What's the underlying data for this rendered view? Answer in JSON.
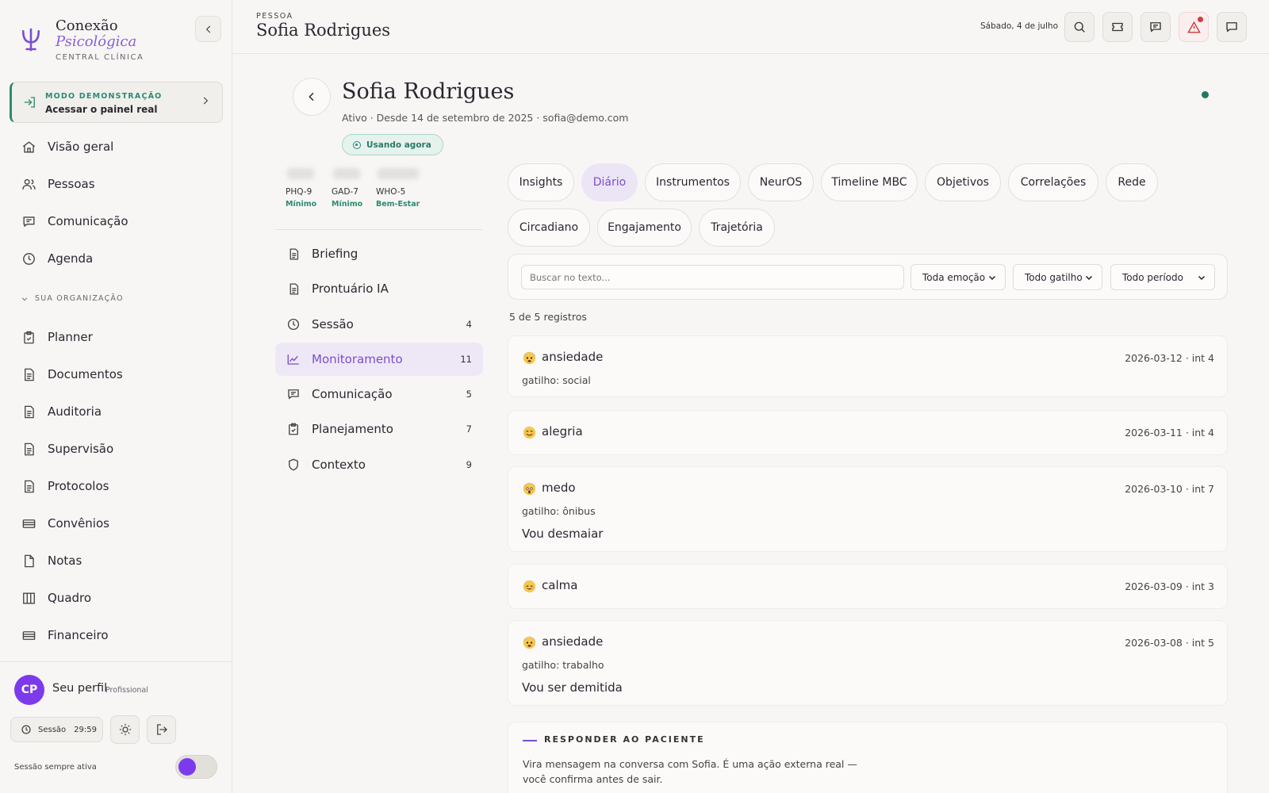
{
  "brand": {
    "line1": "Conexão",
    "line2": "Psicológica",
    "line3": "CENTRAL CLÍNICA"
  },
  "demo": {
    "label": "MODO DEMONSTRAÇÃO",
    "text": "Acessar o painel real"
  },
  "nav": {
    "items": [
      {
        "label": "Visão geral",
        "icon": "home-icon"
      },
      {
        "label": "Pessoas",
        "icon": "users-icon"
      },
      {
        "label": "Comunicação",
        "icon": "chat-icon"
      },
      {
        "label": "Agenda",
        "icon": "clock-icon"
      }
    ],
    "org_label": "SUA ORGANIZAÇÃO",
    "org_items": [
      {
        "label": "Planner",
        "icon": "clipboard-check-icon"
      },
      {
        "label": "Documentos",
        "icon": "document-icon"
      },
      {
        "label": "Auditoria",
        "icon": "document-icon"
      },
      {
        "label": "Supervisão",
        "icon": "document-icon"
      },
      {
        "label": "Protocolos",
        "icon": "document-icon"
      },
      {
        "label": "Convênios",
        "icon": "card-icon"
      },
      {
        "label": "Notas",
        "icon": "file-icon"
      },
      {
        "label": "Quadro",
        "icon": "columns-icon"
      },
      {
        "label": "Financeiro",
        "icon": "card-icon"
      }
    ]
  },
  "profile": {
    "initials": "CP",
    "name": "Seu perfil",
    "role": "Profissional",
    "session_label": "Sessão",
    "session_time": "29:59",
    "always_label": "Sessão sempre ativa",
    "always_on": true
  },
  "topbar": {
    "eyebrow": "PESSOA",
    "title": "Sofia Rodrigues",
    "date": "Sábado, 4 de julho"
  },
  "patient": {
    "name": "Sofia Rodrigues",
    "meta": "Ativo · Desde 14 de setembro de 2025 · sofia@demo.com",
    "badge": "Usando agora"
  },
  "scores": [
    {
      "name": "PHQ-9",
      "severity": "Mínimo"
    },
    {
      "name": "GAD-7",
      "severity": "Mínimo"
    },
    {
      "name": "WHO-5",
      "severity": "Bem-Estar"
    }
  ],
  "sections": [
    {
      "label": "Briefing",
      "count": "",
      "icon": "document-icon"
    },
    {
      "label": "Prontuário IA",
      "count": "",
      "icon": "document-icon"
    },
    {
      "label": "Sessão",
      "count": "4",
      "icon": "clock-icon"
    },
    {
      "label": "Monitoramento",
      "count": "11",
      "icon": "line-chart-icon",
      "active": true
    },
    {
      "label": "Comunicação",
      "count": "5",
      "icon": "chat-icon"
    },
    {
      "label": "Planejamento",
      "count": "7",
      "icon": "clipboard-check-icon"
    },
    {
      "label": "Contexto",
      "count": "9",
      "icon": "shield-icon"
    }
  ],
  "tabs": [
    {
      "label": "Insights"
    },
    {
      "label": "Diário",
      "active": true
    },
    {
      "label": "Instrumentos"
    },
    {
      "label": "NeurOS"
    },
    {
      "label": "Timeline MBC"
    },
    {
      "label": "Objetivos"
    },
    {
      "label": "Correlações"
    },
    {
      "label": "Rede"
    },
    {
      "label": "Circadiano"
    },
    {
      "label": "Engajamento"
    },
    {
      "label": "Trajetória"
    }
  ],
  "filters": {
    "search_placeholder": "Buscar no texto...",
    "emotion": "Toda emoção",
    "trigger": "Todo gatilho",
    "period": "Todo período"
  },
  "records_count": "5 de 5 registros",
  "entries": [
    {
      "emotion": "ansiedade",
      "meta": "2026-03-12 · int 4",
      "trigger": "gatilho: social",
      "text": "",
      "emoji": "😰"
    },
    {
      "emotion": "alegria",
      "meta": "2026-03-11 · int 4",
      "trigger": "",
      "text": "",
      "emoji": "😊"
    },
    {
      "emotion": "medo",
      "meta": "2026-03-10 · int 7",
      "trigger": "gatilho: ônibus",
      "text": "Vou desmaiar",
      "emoji": "😱"
    },
    {
      "emotion": "calma",
      "meta": "2026-03-09 · int 3",
      "trigger": "",
      "text": "",
      "emoji": "😌"
    },
    {
      "emotion": "ansiedade",
      "meta": "2026-03-08 · int 5",
      "trigger": "gatilho: trabalho",
      "text": "Vou ser demitida",
      "emoji": "😰"
    }
  ],
  "reply": {
    "title": "RESPONDER AO PACIENTE",
    "text": "Vira mensagem na conversa com Sofia. É uma ação externa real — você confirma antes de sair."
  },
  "colors": {
    "accent": "#7c4dcf",
    "success": "#2d8a72",
    "alert": "#d93a3a"
  }
}
